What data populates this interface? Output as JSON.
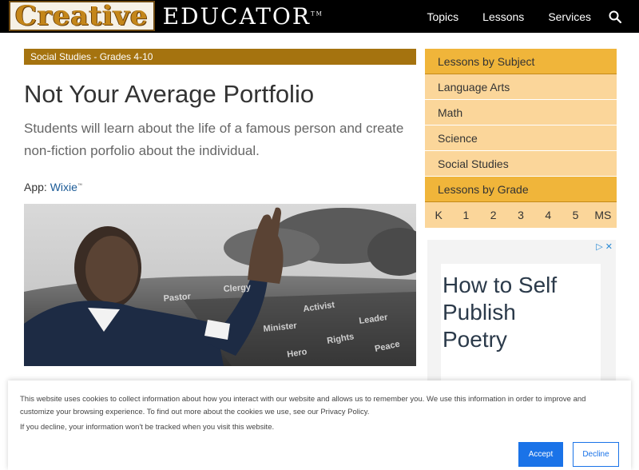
{
  "header": {
    "logo_creative": "Creative",
    "logo_educator": "EDUCATOR",
    "logo_tm": "TM",
    "nav": [
      "Topics",
      "Lessons",
      "Services"
    ]
  },
  "main": {
    "category": "Social Studies - Grades 4-10",
    "title": "Not Your Average Portfolio",
    "subtitle": "Students will learn about the life of a famous person and create non-fiction porfolio about the individual.",
    "app_label": "App:",
    "app_name": "Wixie",
    "app_tm": "™",
    "hero_words": [
      "Activist",
      "Leader",
      "Minister",
      "Rights",
      "Pastor",
      "Clergy",
      "Peace",
      "Hero"
    ]
  },
  "sidebar": {
    "subject_heading": "Lessons by Subject",
    "subjects": [
      "Language Arts",
      "Math",
      "Science",
      "Social Studies"
    ],
    "grade_heading": "Lessons by Grade",
    "grades": [
      "K",
      "1",
      "2",
      "3",
      "4",
      "5",
      "MS"
    ]
  },
  "ad": {
    "title": "How to Self Publish Poetry",
    "icons": "▷ ✕"
  },
  "cookie": {
    "text": "This website uses cookies to collect information about how you interact with our website and allows us to remember you. We use this information in order to improve and customize your browsing experience. To find out more about the cookies we use, see our Privacy Policy.",
    "text2": "If you decline, your information won't be tracked when you visit this website.",
    "accept": "Accept",
    "decline": "Decline"
  }
}
